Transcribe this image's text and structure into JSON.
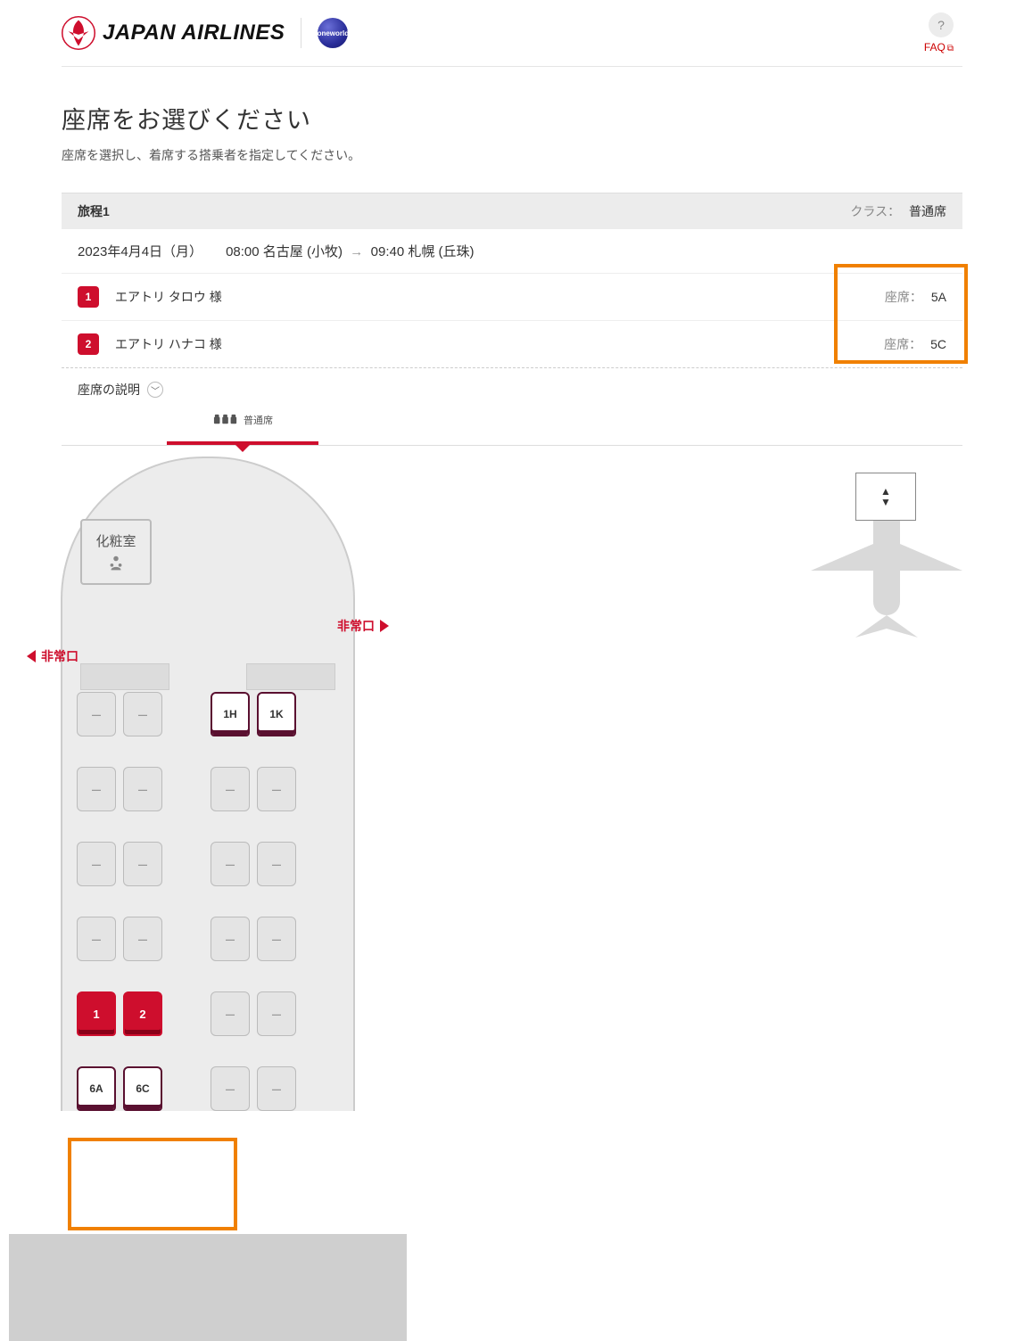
{
  "header": {
    "brand_text": "JAPAN AIRLINES",
    "alliance": "oneworld",
    "help_icon": "?",
    "faq_label": "FAQ"
  },
  "page": {
    "title": "座席をお選びください",
    "subtitle": "座席を選択し、着席する搭乗者を指定してください。"
  },
  "itinerary": {
    "label": "旅程1",
    "class_label": "クラス：",
    "class_value": "普通席",
    "date": "2023年4月4日（月）",
    "dep_time": "08:00",
    "dep_airport": "名古屋 (小牧)",
    "arr_time": "09:40",
    "arr_airport": "札幌 (丘珠)"
  },
  "passengers": [
    {
      "num": "1",
      "name": "エアトリ タロウ 様",
      "seat_label": "座席：",
      "seat": "5A"
    },
    {
      "num": "2",
      "name": "エアトリ ハナコ 様",
      "seat_label": "座席：",
      "seat": "5C"
    }
  ],
  "legend_link": "座席の説明",
  "class_tab": "普通席",
  "lavatory": "化粧室",
  "exit_label": "非常口",
  "seat_grid": {
    "rows": [
      {
        "left": [
          {
            "t": "unavail"
          },
          {
            "t": "unavail"
          }
        ],
        "right": [
          {
            "t": "avail",
            "lbl": "1H"
          },
          {
            "t": "avail",
            "lbl": "1K"
          }
        ]
      },
      {
        "left": [
          {
            "t": "unavail"
          },
          {
            "t": "unavail"
          }
        ],
        "right": [
          {
            "t": "unavail"
          },
          {
            "t": "unavail"
          }
        ]
      },
      {
        "left": [
          {
            "t": "unavail"
          },
          {
            "t": "unavail"
          }
        ],
        "right": [
          {
            "t": "unavail"
          },
          {
            "t": "unavail"
          }
        ]
      },
      {
        "left": [
          {
            "t": "unavail"
          },
          {
            "t": "unavail"
          }
        ],
        "right": [
          {
            "t": "unavail"
          },
          {
            "t": "unavail"
          }
        ]
      },
      {
        "left": [
          {
            "t": "selected",
            "lbl": "1"
          },
          {
            "t": "selected",
            "lbl": "2"
          }
        ],
        "right": [
          {
            "t": "unavail"
          },
          {
            "t": "unavail"
          }
        ]
      },
      {
        "left": [
          {
            "t": "avail",
            "lbl": "6A"
          },
          {
            "t": "avail",
            "lbl": "6C"
          }
        ],
        "right": [
          {
            "t": "unavail"
          },
          {
            "t": "unavail"
          }
        ]
      }
    ]
  }
}
